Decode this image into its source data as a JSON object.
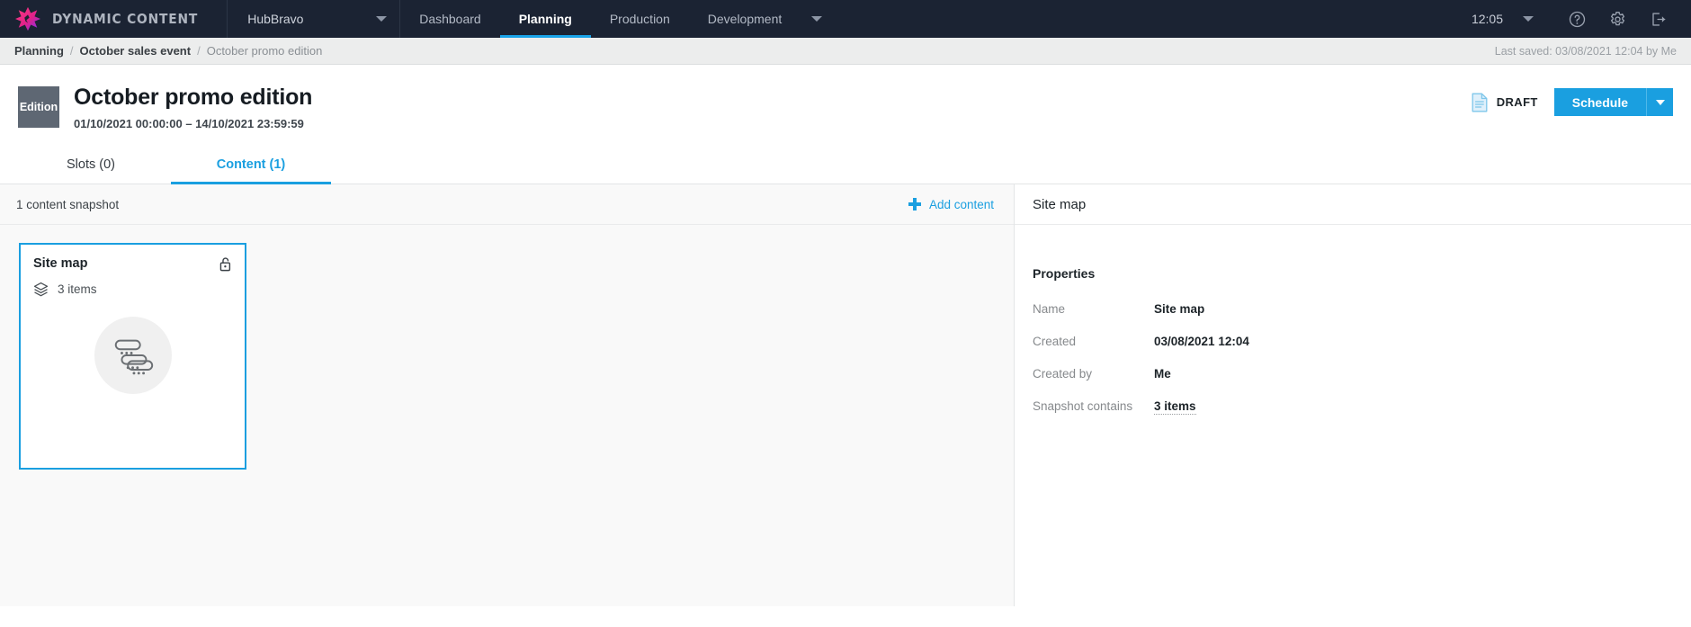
{
  "topbar": {
    "logo_icon": "dynamic-content-star-logo",
    "brand": "DYNAMIC CONTENT",
    "account": "HubBravo",
    "account_caret_icon": "chevron-down-icon",
    "nav": [
      {
        "label": "Dashboard",
        "active": false
      },
      {
        "label": "Planning",
        "active": true
      },
      {
        "label": "Production",
        "active": false
      },
      {
        "label": "Development",
        "active": false
      }
    ],
    "nav_caret_icon": "chevron-down-icon",
    "clock": "12:05",
    "clock_caret_icon": "chevron-down-icon",
    "help_icon": "help-circle-icon",
    "settings_icon": "gear-icon",
    "logout_icon": "logout-icon",
    "accent": "#1aa3e8",
    "background": "#1b2333"
  },
  "breadcrumb": {
    "items": [
      {
        "label": "Planning",
        "current": false
      },
      {
        "label": "October sales event",
        "current": false
      },
      {
        "label": "October promo edition",
        "current": true
      }
    ],
    "separator": "/",
    "last_saved": "Last saved: 03/08/2021 12:04 by Me"
  },
  "header": {
    "badge": "Edition",
    "title": "October promo edition",
    "dates": "01/10/2021 00:00:00  –  14/10/2021 23:59:59",
    "status_icon": "draft-document-icon",
    "status": "DRAFT",
    "schedule_label": "Schedule",
    "schedule_caret_icon": "chevron-down-icon",
    "primary_color": "#1a9fe0",
    "badge_color": "#5e6773"
  },
  "tabs": [
    {
      "label": "Slots (0)",
      "active": false
    },
    {
      "label": "Content (1)",
      "active": true
    }
  ],
  "left_pane": {
    "snapshot_count": "1 content snapshot",
    "add_content_icon": "plus-icon",
    "add_content_label": "Add content",
    "card": {
      "title": "Site map",
      "lock_icon": "unlocked-padlock-icon",
      "layers_icon": "layers-icon",
      "items_label": "3 items",
      "thumb_icon": "site-map-icon"
    }
  },
  "right_pane": {
    "header": "Site map",
    "properties_title": "Properties",
    "properties": [
      {
        "key": "Name",
        "value": "Site map",
        "dotted": false
      },
      {
        "key": "Created",
        "value": "03/08/2021 12:04",
        "dotted": false
      },
      {
        "key": "Created by",
        "value": "Me",
        "dotted": false
      },
      {
        "key": "Snapshot contains",
        "value": "3 items",
        "dotted": true
      }
    ]
  }
}
